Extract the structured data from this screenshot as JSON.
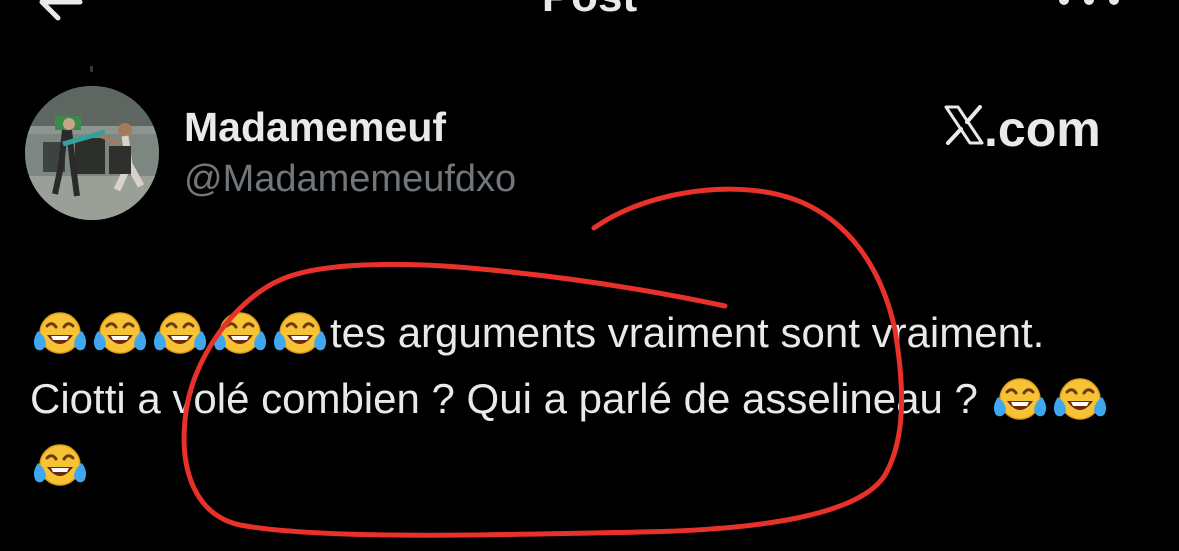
{
  "header": {
    "title": "Post",
    "back_icon": "arrow-left-icon",
    "more_icon": "more-horizontal-icon"
  },
  "author": {
    "display_name": "Madamemeuf",
    "handle": "@Madamemeufdxo"
  },
  "watermark": {
    "logo": "x-logo-icon",
    "text": ".com"
  },
  "post": {
    "segments": [
      {
        "type": "emoji",
        "icon": "face-with-tears-of-joy-icon"
      },
      {
        "type": "emoji",
        "icon": "face-with-tears-of-joy-icon"
      },
      {
        "type": "emoji",
        "icon": "face-with-tears-of-joy-icon"
      },
      {
        "type": "emoji",
        "icon": "face-with-tears-of-joy-icon"
      },
      {
        "type": "emoji",
        "icon": "face-with-tears-of-joy-icon"
      },
      {
        "type": "text",
        "text": "tes arguments vraiment sont vraiment. Ciotti a volé combien ? Qui a parlé de asselineau ? "
      },
      {
        "type": "emoji",
        "icon": "face-with-tears-of-joy-icon"
      },
      {
        "type": "emoji",
        "icon": "face-with-tears-of-joy-icon"
      },
      {
        "type": "emoji",
        "icon": "face-with-tears-of-joy-icon"
      }
    ]
  },
  "colors": {
    "background": "#000000",
    "primary_text": "#e7e9ea",
    "secondary_text": "#71767b",
    "annotation": "#e8312a"
  }
}
